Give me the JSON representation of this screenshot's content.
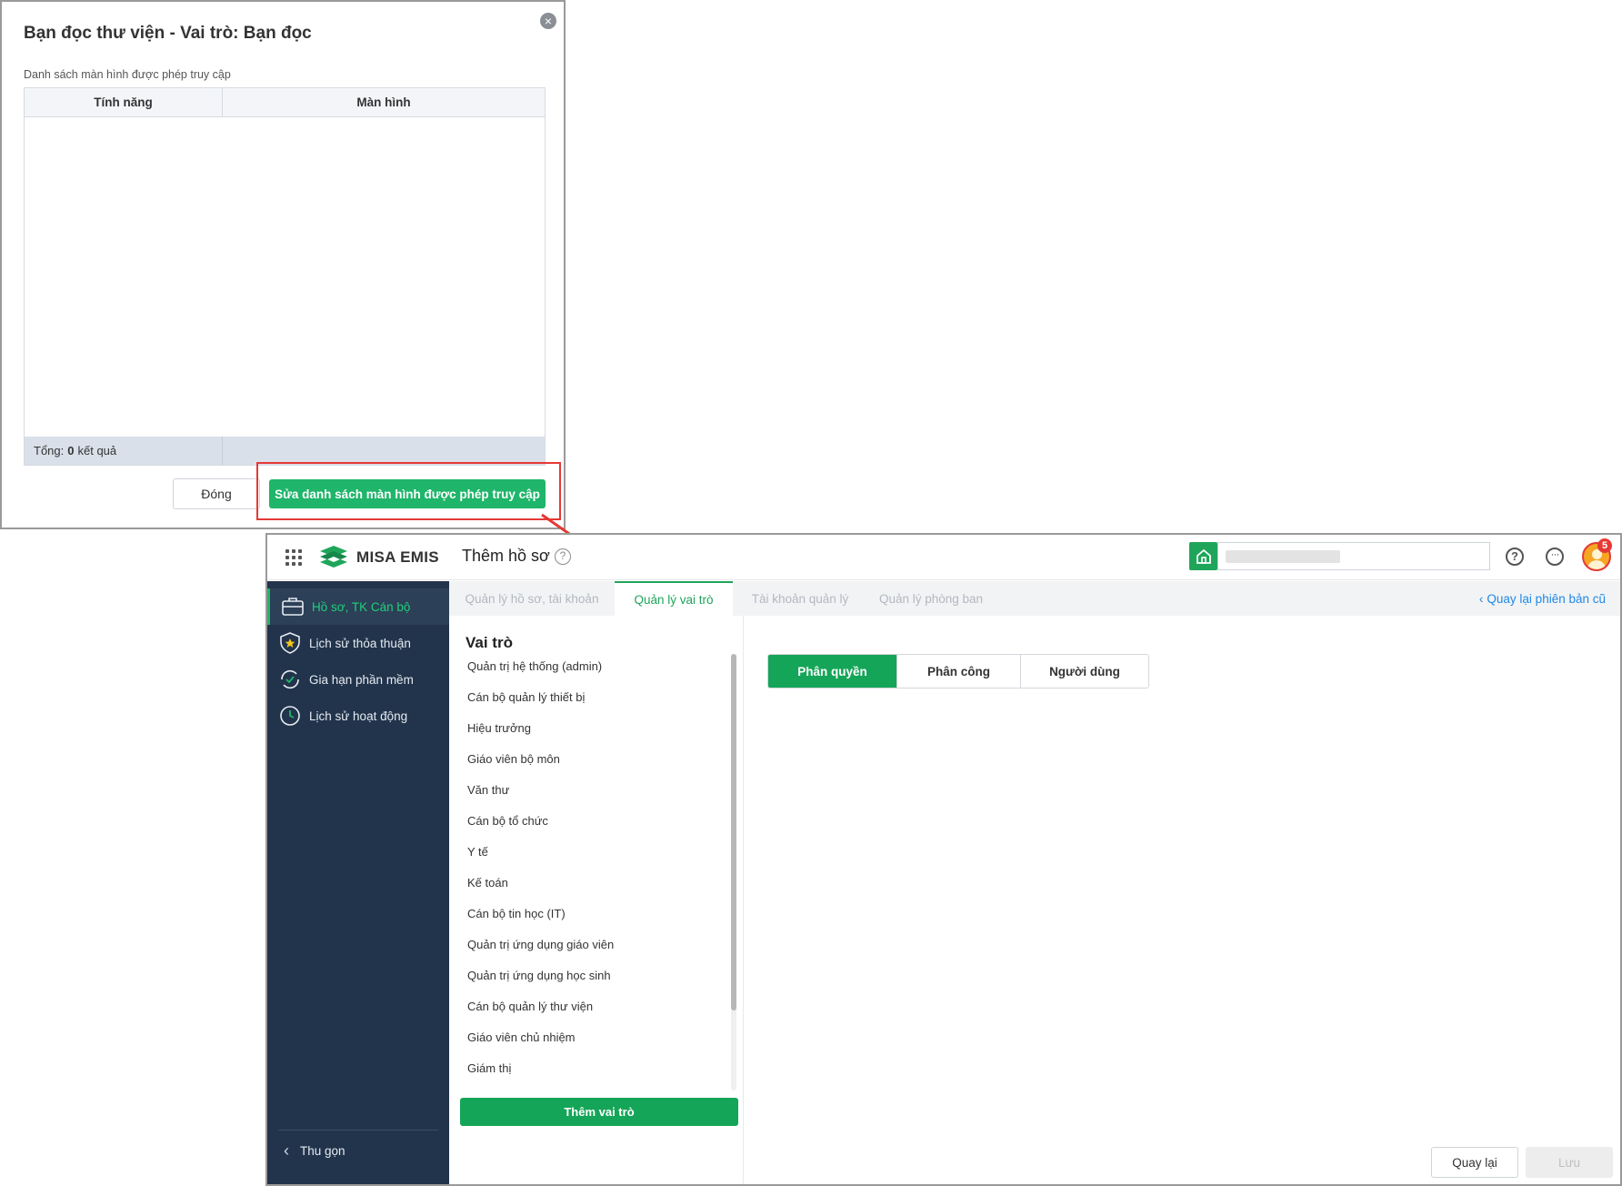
{
  "dialog": {
    "title": "Bạn đọc thư viện - Vai trò: Bạn đọc",
    "close_icon": "×",
    "subtitle": "Danh sách màn hình được phép truy cập",
    "columns": [
      "Tính năng",
      "Màn hình"
    ],
    "footer_total_label": "Tổng:",
    "footer_total_count": "0",
    "footer_total_suffix": "kết quả",
    "close_button": "Đóng",
    "edit_button": "Sửa danh sách màn hình được phép truy cập",
    "highlight_color": "#e53935"
  },
  "app": {
    "logo_text": "MISA EMIS",
    "page_title": "Thêm hồ sơ",
    "help_glyph": "?",
    "more_glyph": "···",
    "notification_count": "5",
    "accent_color": "#15a558",
    "sidebar": {
      "items": [
        {
          "label": "Hồ sơ, TK Cán bộ",
          "icon": "briefcase-icon",
          "active": true
        },
        {
          "label": "Lịch sử thỏa thuận",
          "icon": "shield-star-icon",
          "active": false
        },
        {
          "label": "Gia hạn phần mềm",
          "icon": "renew-icon",
          "active": false
        },
        {
          "label": "Lịch sử hoạt động",
          "icon": "clock-icon",
          "active": false
        }
      ],
      "collapse_label": "Thu gọn",
      "collapse_icon": "‹"
    },
    "tabs": [
      {
        "label": "Quản lý hồ sơ, tài khoản",
        "active": false
      },
      {
        "label": "Quản lý vai trò",
        "active": true
      },
      {
        "label": "Tài khoản quản lý",
        "active": false
      },
      {
        "label": "Quản lý phòng ban",
        "active": false
      }
    ],
    "back_link": "Quay lại phiên bản cũ",
    "back_link_icon": "‹",
    "roles": {
      "title": "Vai trò",
      "items": [
        "Quản trị hệ thống (admin)",
        "Cán bộ quản lý thiết bị",
        "Hiệu trưởng",
        "Giáo viên bộ môn",
        "Văn thư",
        "Cán bộ tổ chức",
        "Y tế",
        "Kế toán",
        "Cán bộ tin học (IT)",
        "Quản trị ứng dụng giáo viên",
        "Quản trị ứng dụng học sinh",
        "Cán bộ quản lý thư viện",
        "Giáo viên chủ nhiệm",
        "Giám thị"
      ],
      "add_button": "Thêm vai trò"
    },
    "segments": [
      {
        "label": "Phân quyền",
        "active": true
      },
      {
        "label": "Phân công",
        "active": false
      },
      {
        "label": "Người dùng",
        "active": false
      }
    ],
    "footer_back": "Quay lại",
    "footer_save": "Lưu"
  }
}
